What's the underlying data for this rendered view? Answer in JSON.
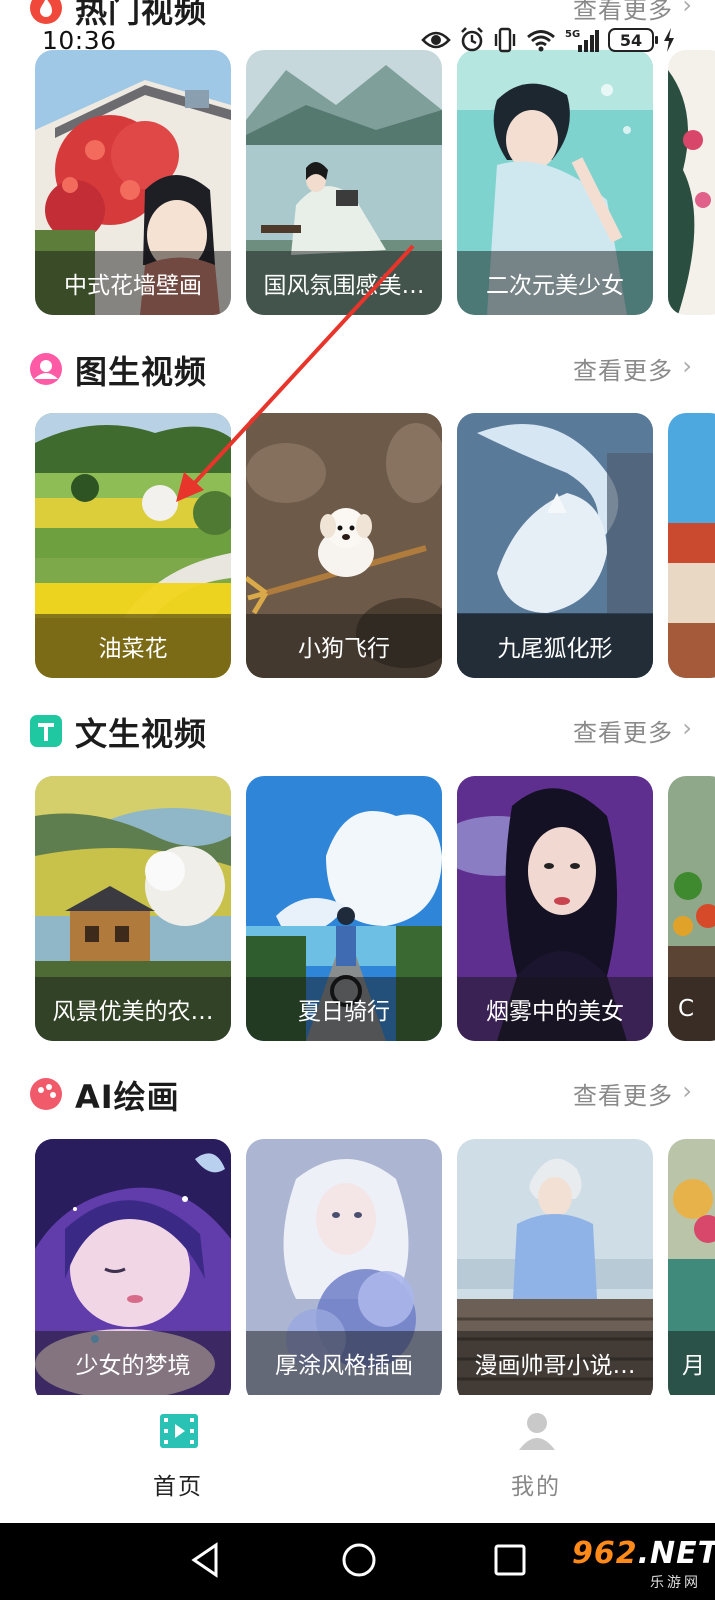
{
  "status_bar": {
    "time": "10:36",
    "battery": "54"
  },
  "sections": {
    "hot": {
      "title": "热门视频",
      "more": "查看更多",
      "cards": [
        "中式花墙壁画",
        "国风氛围感美…",
        "二次元美少女",
        ""
      ]
    },
    "img2video": {
      "title": "图生视频",
      "more": "查看更多",
      "cards": [
        "油菜花",
        "小狗飞行",
        "九尾狐化形",
        ""
      ]
    },
    "text2video": {
      "title": "文生视频",
      "more": "查看更多",
      "cards": [
        "风景优美的农…",
        "夏日骑行",
        "烟雾中的美女",
        "C"
      ]
    },
    "ai_paint": {
      "title": "AI绘画",
      "more": "查看更多",
      "cards": [
        "少女的梦境",
        "厚涂风格插画",
        "漫画帅哥小说…",
        "月"
      ]
    }
  },
  "bottom_nav": {
    "home": "首页",
    "mine": "我的"
  },
  "watermark": {
    "brand_num": "962",
    "brand_suffix": ".NET",
    "brand_cn": "乐游网"
  },
  "colors": {
    "hot_icon": "#f0483a",
    "img2video_icon": "#ff5aa5",
    "text2video_icon": "#1fc8a0",
    "ai_paint_icon": "#f05a6a",
    "annotation_arrow": "#e8352b",
    "home_icon": "#29c2b4"
  }
}
